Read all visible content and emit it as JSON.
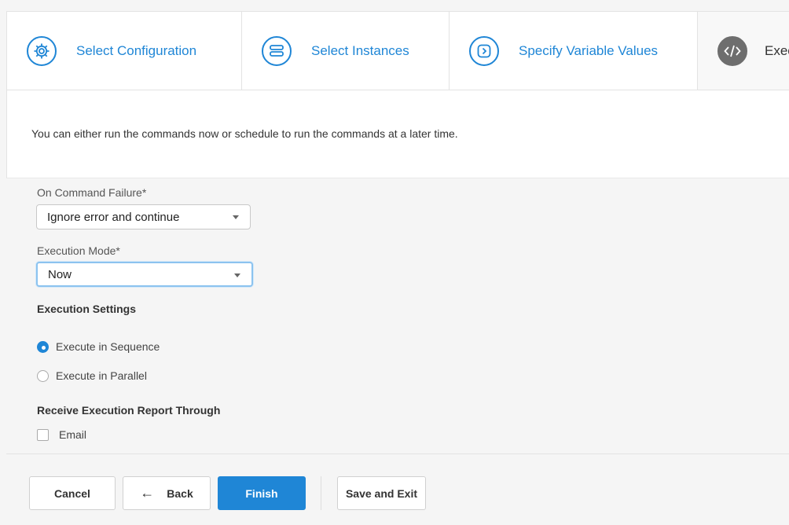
{
  "stepper": {
    "steps": [
      {
        "label": "Select Configuration",
        "icon": "gear-icon"
      },
      {
        "label": "Select Instances",
        "icon": "server-icon"
      },
      {
        "label": "Specify Variable Values",
        "icon": "chevron-right-icon"
      },
      {
        "label": "Exec",
        "icon": "code-icon"
      }
    ]
  },
  "intro": {
    "text": "You can either run the commands now or schedule to run the commands at a later time."
  },
  "form": {
    "on_failure": {
      "label": "On Command Failure*",
      "value": "Ignore error and continue"
    },
    "execution_mode": {
      "label": "Execution Mode*",
      "value": "Now"
    },
    "execution_settings": {
      "title": "Execution Settings",
      "options": [
        {
          "label": "Execute in Sequence",
          "selected": true
        },
        {
          "label": "Execute in Parallel",
          "selected": false
        }
      ]
    },
    "report": {
      "title": "Receive Execution Report Through",
      "email_label": "Email"
    }
  },
  "footer": {
    "cancel": "Cancel",
    "back": "Back",
    "back_arrow": "←",
    "finish": "Finish",
    "save_exit": "Save and Exit"
  },
  "colors": {
    "accent": "#1f86d6",
    "current_step": "#6e6e6e",
    "focus_ring": "#8cc3ef"
  }
}
